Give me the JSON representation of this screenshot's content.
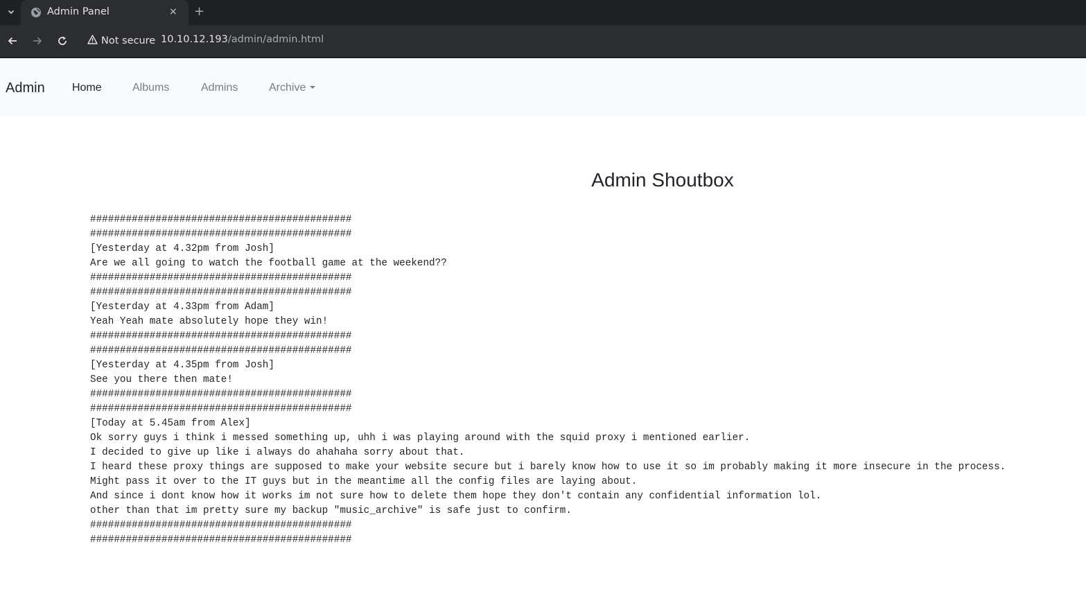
{
  "browser": {
    "tab_title": "Admin Panel",
    "tab_close": "×",
    "new_tab": "+",
    "security_label": "Not secure",
    "url_host": "10.10.12.193",
    "url_path": "/admin/admin.html"
  },
  "navbar": {
    "brand": "Admin",
    "links": [
      {
        "label": "Home",
        "active": true
      },
      {
        "label": "Albums",
        "active": false
      },
      {
        "label": "Admins",
        "active": false
      },
      {
        "label": "Archive",
        "active": false,
        "dropdown": true
      }
    ]
  },
  "page": {
    "heading": "Admin Shoutbox",
    "lines": [
      "############################################",
      "############################################",
      "[Yesterday at 4.32pm from Josh]",
      "Are we all going to watch the football game at the weekend??",
      "############################################",
      "############################################",
      "[Yesterday at 4.33pm from Adam]",
      "Yeah Yeah mate absolutely hope they win!",
      "############################################",
      "############################################",
      "[Yesterday at 4.35pm from Josh]",
      "See you there then mate!",
      "############################################",
      "############################################",
      "[Today at 5.45am from Alex]",
      "Ok sorry guys i think i messed something up, uhh i was playing around with the squid proxy i mentioned earlier.",
      "I decided to give up like i always do ahahaha sorry about that.",
      "I heard these proxy things are supposed to make your website secure but i barely know how to use it so im probably making it more insecure in the process.",
      "Might pass it over to the IT guys but in the meantime all the config files are laying about.",
      "And since i dont know how it works im not sure how to delete them hope they don't contain any confidential information lol.",
      "other than that im pretty sure my backup \"music_archive\" is safe just to confirm.",
      "############################################",
      "############################################"
    ]
  }
}
